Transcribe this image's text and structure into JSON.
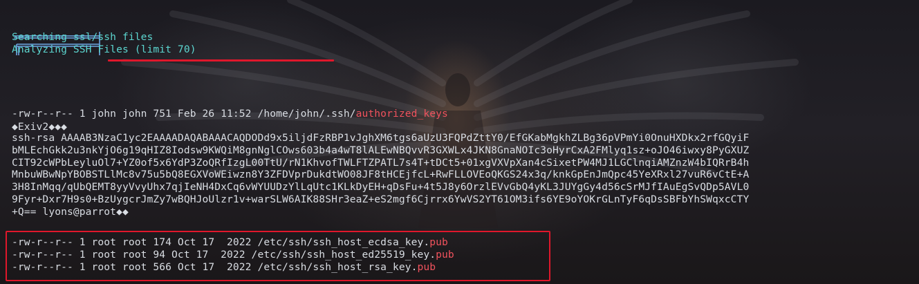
{
  "banner": {
    "icon": "linpeas-section-icon",
    "line1": "Searching ssl/ssh files",
    "line2": "Analyzing SSH Files (limit 70)"
  },
  "authorized_keys_entry": {
    "listing_prefix": "-rw-r--r-- 1 john john 751 Feb 26 11:52 /home/john/.ssh/",
    "listing_highlight": "authorized_keys",
    "exif_line": "◆Exiv2◆◆◆",
    "key_lines": [
      "ssh-rsa AAAAB3NzaC1yc2EAAAADAQABAAACAQDODd9x5iljdFzRBP1vJghXM6tgs6aUzU3FQPdZttY0/EfGKabMgkhZLBg36pVPmYi0OnuHXDkx2rfGQyiF",
      "bMLEchGkk2u3nkYjO6g19qHIZ8Iodsw9KWQiM8gnNglCOws603b4a4wT8lALEwNBQvvR3GXWLx4JKN8GnaNOIc3oHyrCxA2FMlyq1sz+oJO46iwxy8PyGXUZ",
      "CIT92cWPbLeyluOl7+YZ0of5x6YdP3ZoQRfIzgL00TtU/rN1KhvofTWLFTZPATL7s4T+tDCt5+01xgVXVpXan4cSixetPW4MJ1LGClnqiAMZnzW4bIQRrB4h",
      "MnbuWBwNpYBOBSTLlMc8v75u5bQ8EGXVoWEiwzn8Y3ZFDVprDukdtWO08JF8tHCEjfcL+RwFLLOVEoQKGS24x3q/knkGpEnJmQpc45YeXRxl27vuR6vCtE+A",
      "3H8InMqq/qUbQEMT8yyVvyUhx7qjIeNH4DxCq6vWYUUDzYlLqUtc1KLkDyEH+qDsFu+4t5J8y6OrzlEVvGbQ4yKL3JUYgGy4d56cSrMJfIAuEgSvQDp5AVL0",
      "9Fyr+Dxr7H9s0+BzUygcrJmZy7wBQHJoUlzr1v+warSLW6AIK88SHr3eaZ+eS2mgf6Cjrrx6YwVS2YT61OM3ifs6YE9oYOKrGLnTyF6qDsSBFbYhSWqxcCTY",
      "+Q== lyons@parrot◆◆"
    ]
  },
  "host_keys": [
    {
      "prefix": "-rw-r--r-- 1 root root 174 Oct 17  2022 /etc/ssh/ssh_host_ecdsa_key.",
      "ext": "pub"
    },
    {
      "prefix": "-rw-r--r-- 1 root root 94 Oct 17  2022 /etc/ssh/ssh_host_ed25519_key.",
      "ext": "pub"
    },
    {
      "prefix": "-rw-r--r-- 1 root root 566 Oct 17  2022 /etc/ssh/ssh_host_rsa_key.",
      "ext": "pub"
    }
  ],
  "colors": {
    "text": "#d9dde3",
    "section_text": "#5cd6d0",
    "highlight": "#f0525d",
    "annotation": "#e0172b",
    "background": "#15131a"
  }
}
